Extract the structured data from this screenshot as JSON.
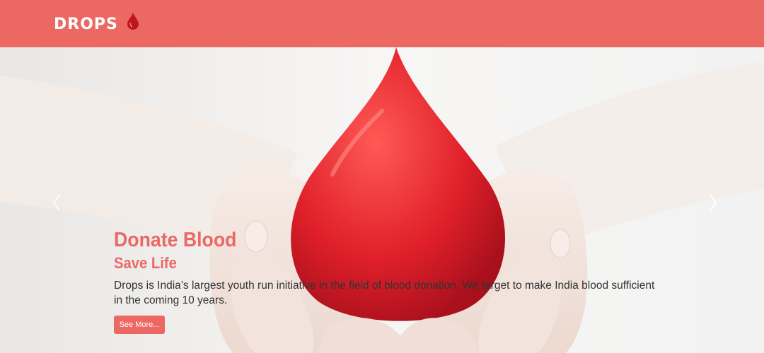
{
  "header": {
    "brand": "DROPS",
    "drop_icon": "blood-drop-icon",
    "bg_color": "#ec6863",
    "drop_color": "#c0141e"
  },
  "hero": {
    "title": "Donate Blood",
    "subtitle": "Save Life",
    "description": "Drops is India’s largest youth run initiative in the field of blood donation. We target to make India blood sufficient in the coming 10 years.",
    "button_label": "See More...",
    "prev_icon": "chevron-left-icon",
    "next_icon": "chevron-right-icon",
    "accent_color": "#ec6863"
  }
}
